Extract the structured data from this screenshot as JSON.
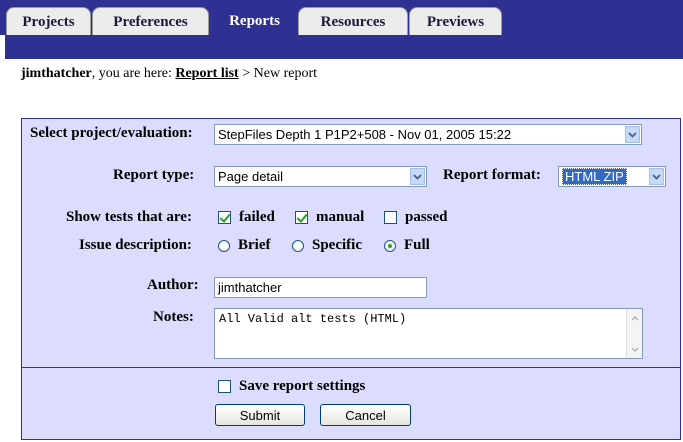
{
  "tabs": [
    {
      "label": "Projects",
      "active": false
    },
    {
      "label": "Preferences",
      "active": false
    },
    {
      "label": "Reports",
      "active": true
    },
    {
      "label": "Resources",
      "active": false
    },
    {
      "label": "Previews",
      "active": false
    }
  ],
  "breadcrumb": {
    "user": "jimthatcher",
    "prefix": ", you are here: ",
    "link": "Report list",
    "separator": " > ",
    "current": "New report"
  },
  "form": {
    "project_label": "Select project/evaluation:",
    "project_value": "StepFiles Depth 1 P1P2+508 - Nov 01, 2005 15:22",
    "report_type_label": "Report type:",
    "report_type_value": "Page detail",
    "report_format_label": "Report format:",
    "report_format_value": "HTML ZIP",
    "show_tests_label": "Show tests that are:",
    "show_tests": [
      {
        "label": "failed",
        "checked": true
      },
      {
        "label": "manual",
        "checked": true
      },
      {
        "label": "passed",
        "checked": false
      }
    ],
    "issue_label": "Issue description:",
    "issue_options": [
      {
        "label": "Brief",
        "checked": false
      },
      {
        "label": "Specific",
        "checked": false
      },
      {
        "label": "Full",
        "checked": true
      }
    ],
    "author_label": "Author:",
    "author_value": "jimthatcher",
    "notes_label": "Notes:",
    "notes_value": "All Valid alt tests (HTML)",
    "save_settings_label": "Save report settings",
    "save_settings_checked": false,
    "submit_label": "Submit",
    "cancel_label": "Cancel"
  },
  "colors": {
    "header_bg": "#2e3192",
    "panel_bg": "#dcdcff",
    "check_mark": "#21a121"
  },
  "icons": {
    "dropdown": "chevron-down-icon",
    "scroll_up": "scroll-up-icon",
    "scroll_down": "scroll-down-icon"
  }
}
